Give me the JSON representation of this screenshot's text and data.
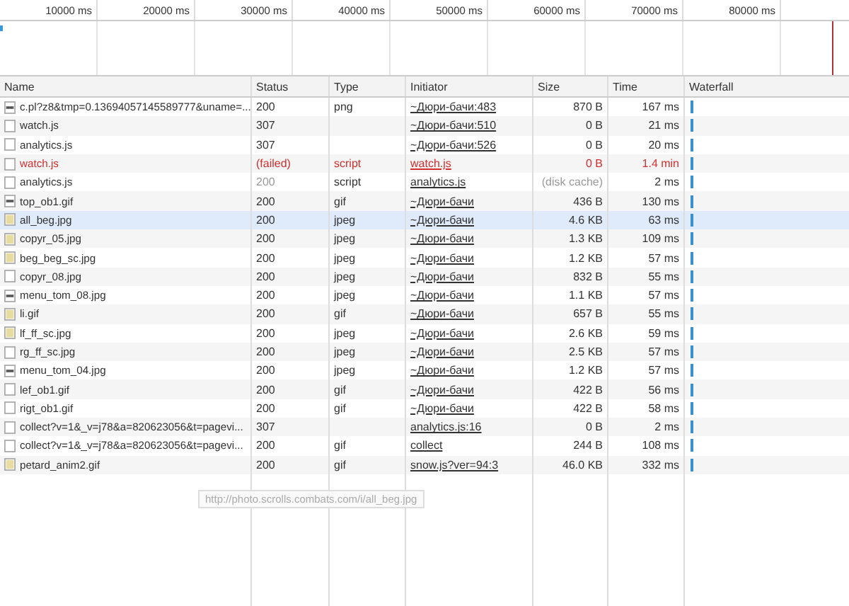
{
  "overview": {
    "ticks": [
      "10000 ms",
      "20000 ms",
      "30000 ms",
      "40000 ms",
      "50000 ms",
      "60000 ms",
      "70000 ms",
      "80000 ms"
    ]
  },
  "table": {
    "columns": [
      "Name",
      "Status",
      "Type",
      "Initiator",
      "Size",
      "Time",
      "Waterfall"
    ],
    "rows": [
      {
        "kind": "image",
        "name": "c.pl?z8&tmp=0.13694057145589777&uname=...",
        "status": "200",
        "type": "png",
        "initiator": "~Дюри-бачи:483",
        "size": "870 B",
        "time": "167 ms",
        "failed": false,
        "selected": false,
        "cached": false
      },
      {
        "kind": "doc",
        "name": "watch.js",
        "status": "307",
        "type": "",
        "initiator": "~Дюри-бачи:510",
        "size": "0 B",
        "time": "21 ms",
        "failed": false,
        "selected": false,
        "cached": false
      },
      {
        "kind": "doc",
        "name": "analytics.js",
        "status": "307",
        "type": "",
        "initiator": "~Дюри-бачи:526",
        "size": "0 B",
        "time": "20 ms",
        "failed": false,
        "selected": false,
        "cached": false
      },
      {
        "kind": "doc",
        "name": "watch.js",
        "status": "(failed)",
        "type": "script",
        "initiator": "watch.js",
        "size": "0 B",
        "time": "1.4 min",
        "failed": true,
        "selected": false,
        "cached": false
      },
      {
        "kind": "doc",
        "name": "analytics.js",
        "status": "200",
        "type": "script",
        "initiator": "analytics.js",
        "size": "(disk cache)",
        "time": "2 ms",
        "failed": false,
        "selected": false,
        "cached": true
      },
      {
        "kind": "image",
        "name": "top_ob1.gif",
        "status": "200",
        "type": "gif",
        "initiator": "~Дюри-бачи",
        "size": "436 B",
        "time": "130 ms",
        "failed": false,
        "selected": false,
        "cached": false
      },
      {
        "kind": "photo",
        "name": "all_beg.jpg",
        "status": "200",
        "type": "jpeg",
        "initiator": "~Дюри-бачи",
        "size": "4.6 KB",
        "time": "63 ms",
        "failed": false,
        "selected": true,
        "cached": false
      },
      {
        "kind": "photo",
        "name": "copyr_05.jpg",
        "status": "200",
        "type": "jpeg",
        "initiator": "~Дюри-бачи",
        "size": "1.3 KB",
        "time": "109 ms",
        "failed": false,
        "selected": false,
        "cached": false
      },
      {
        "kind": "photo",
        "name": "beg_beg_sc.jpg",
        "status": "200",
        "type": "jpeg",
        "initiator": "~Дюри-бачи",
        "size": "1.2 KB",
        "time": "57 ms",
        "failed": false,
        "selected": false,
        "cached": false
      },
      {
        "kind": "doc",
        "name": "copyr_08.jpg",
        "status": "200",
        "type": "jpeg",
        "initiator": "~Дюри-бачи",
        "size": "832 B",
        "time": "55 ms",
        "failed": false,
        "selected": false,
        "cached": false
      },
      {
        "kind": "image",
        "name": "menu_tom_08.jpg",
        "status": "200",
        "type": "jpeg",
        "initiator": "~Дюри-бачи",
        "size": "1.1 KB",
        "time": "57 ms",
        "failed": false,
        "selected": false,
        "cached": false
      },
      {
        "kind": "photo",
        "name": "li.gif",
        "status": "200",
        "type": "gif",
        "initiator": "~Дюри-бачи",
        "size": "657 B",
        "time": "55 ms",
        "failed": false,
        "selected": false,
        "cached": false
      },
      {
        "kind": "photo",
        "name": "lf_ff_sc.jpg",
        "status": "200",
        "type": "jpeg",
        "initiator": "~Дюри-бачи",
        "size": "2.6 KB",
        "time": "59 ms",
        "failed": false,
        "selected": false,
        "cached": false
      },
      {
        "kind": "doc",
        "name": "rg_ff_sc.jpg",
        "status": "200",
        "type": "jpeg",
        "initiator": "~Дюри-бачи",
        "size": "2.5 KB",
        "time": "57 ms",
        "failed": false,
        "selected": false,
        "cached": false
      },
      {
        "kind": "image",
        "name": "menu_tom_04.jpg",
        "status": "200",
        "type": "jpeg",
        "initiator": "~Дюри-бачи",
        "size": "1.2 KB",
        "time": "57 ms",
        "failed": false,
        "selected": false,
        "cached": false
      },
      {
        "kind": "doc",
        "name": "lef_ob1.gif",
        "status": "200",
        "type": "gif",
        "initiator": "~Дюри-бачи",
        "size": "422 B",
        "time": "56 ms",
        "failed": false,
        "selected": false,
        "cached": false
      },
      {
        "kind": "doc",
        "name": "rigt_ob1.gif",
        "status": "200",
        "type": "gif",
        "initiator": "~Дюри-бачи",
        "size": "422 B",
        "time": "58 ms",
        "failed": false,
        "selected": false,
        "cached": false
      },
      {
        "kind": "doc",
        "name": "collect?v=1&_v=j78&a=820623056&t=pagevi...",
        "status": "307",
        "type": "",
        "initiator": "analytics.js:16",
        "size": "0 B",
        "time": "2 ms",
        "failed": false,
        "selected": false,
        "cached": false
      },
      {
        "kind": "doc",
        "name": "collect?v=1&_v=j78&a=820623056&t=pagevi...",
        "status": "200",
        "type": "gif",
        "initiator": "collect",
        "size": "244 B",
        "time": "108 ms",
        "failed": false,
        "selected": false,
        "cached": false
      },
      {
        "kind": "photo",
        "name": "petard_anim2.gif",
        "status": "200",
        "type": "gif",
        "initiator": "snow.js?ver=94:3",
        "size": "46.0 KB",
        "time": "332 ms",
        "failed": false,
        "selected": false,
        "cached": false
      }
    ]
  },
  "tooltip": {
    "text": "http://photo.scrolls.combats.com/i/all_beg.jpg"
  }
}
